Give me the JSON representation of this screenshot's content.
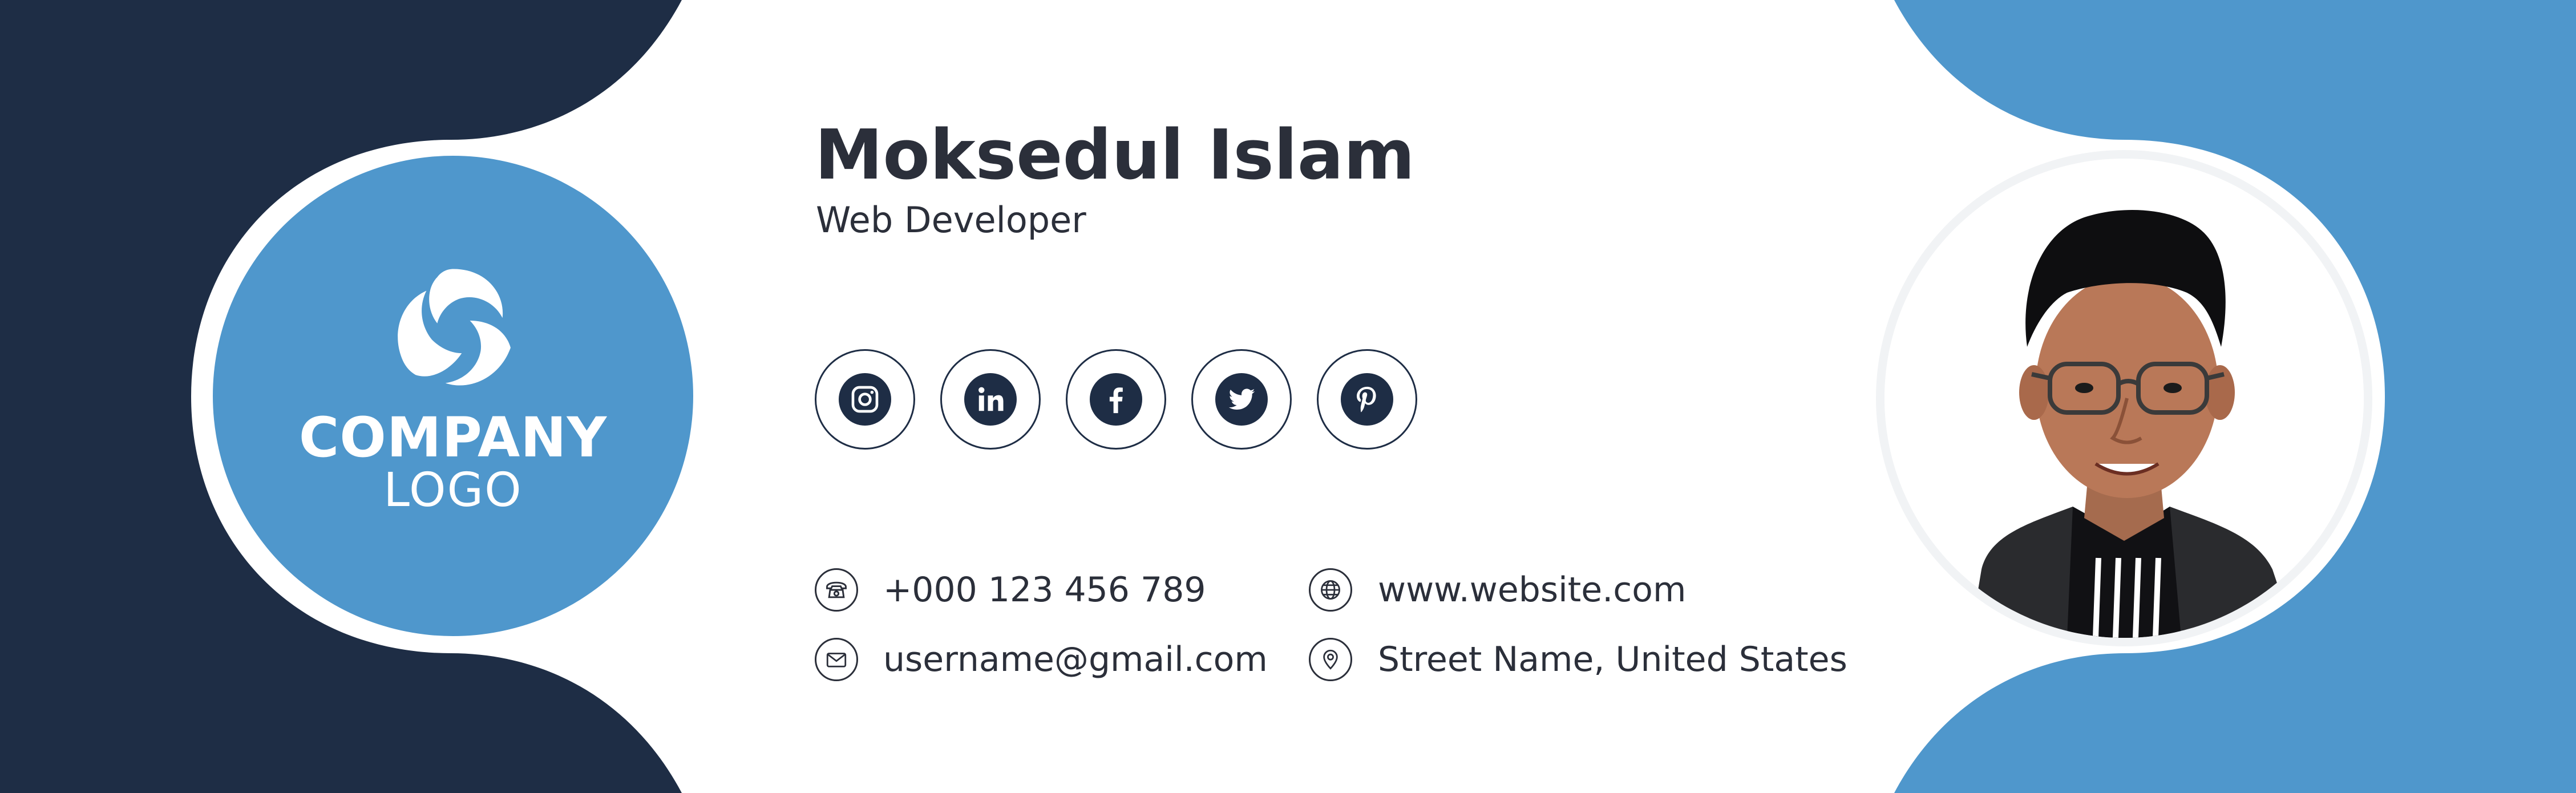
{
  "colors": {
    "navy": "#1e2d45",
    "blue": "#4f97cc",
    "text": "#2b2f3a",
    "white": "#ffffff"
  },
  "logo": {
    "line1": "COMPANY",
    "line2": "LOGO",
    "mark_icon": "three-swirl-logo-icon"
  },
  "profile": {
    "name": "Moksedul Islam",
    "title": "Web Developer",
    "photo_icon": "person-photo"
  },
  "social": [
    {
      "name": "instagram",
      "icon": "instagram-icon"
    },
    {
      "name": "linkedin",
      "icon": "linkedin-icon"
    },
    {
      "name": "facebook",
      "icon": "facebook-icon"
    },
    {
      "name": "twitter",
      "icon": "twitter-icon"
    },
    {
      "name": "pinterest",
      "icon": "pinterest-icon"
    }
  ],
  "contact": {
    "phone": "+000 123 456 789",
    "email": "username@gmail.com",
    "website": "www.website.com",
    "address": "Street Name, United States"
  }
}
